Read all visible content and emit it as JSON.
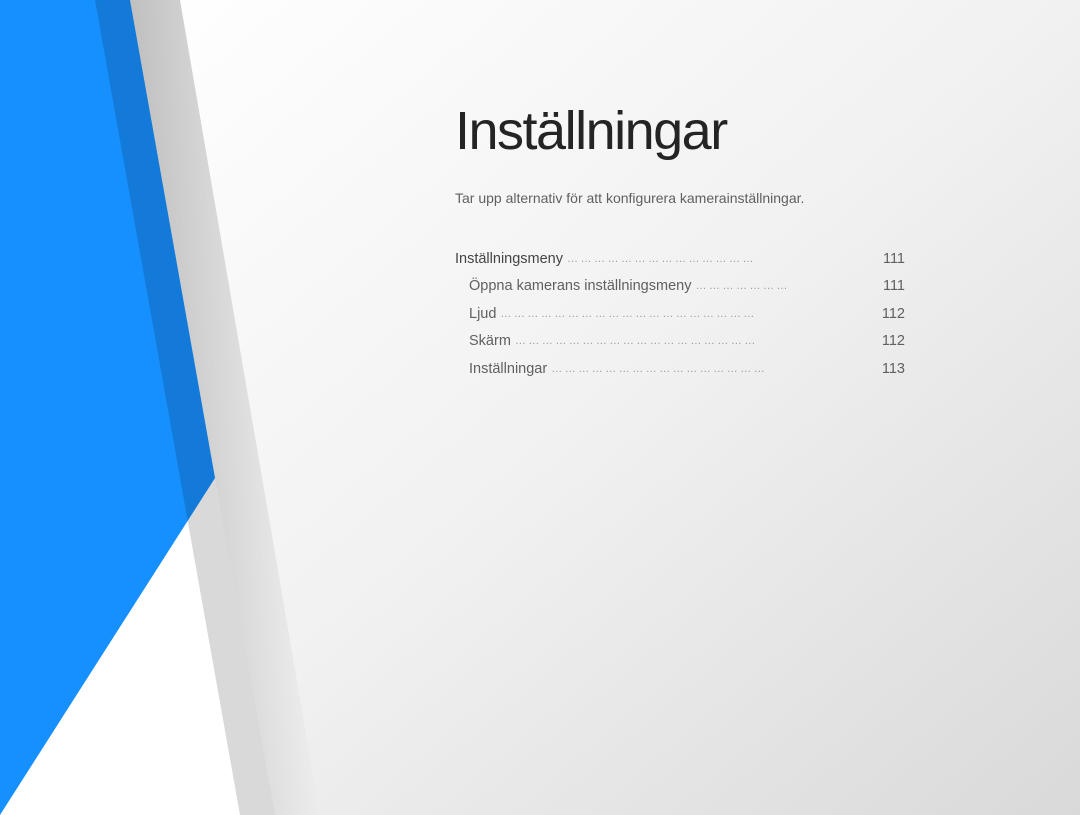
{
  "title": "Inställningar",
  "subtitle": "Tar upp alternativ för att konfigurera kamerainställningar.",
  "toc": {
    "main": {
      "label": "Inställningsmeny",
      "page": "111"
    },
    "items": [
      {
        "label": "Öppna kamerans inställningsmeny",
        "page": "111"
      },
      {
        "label": "Ljud",
        "page": "112"
      },
      {
        "label": "Skärm",
        "page": "112"
      },
      {
        "label": "Inställningar",
        "page": "113"
      }
    ]
  },
  "colors": {
    "blue": "#1790ff",
    "gray_light": "#f2f2f2",
    "gray_dark": "#dadada"
  }
}
